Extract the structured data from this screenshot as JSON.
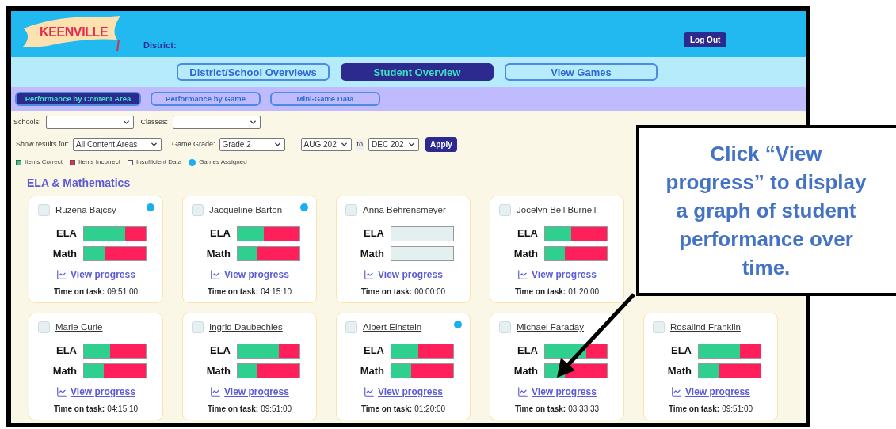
{
  "header": {
    "logo": "KEENVILLE",
    "district_label": "District:",
    "logout": "Log Out"
  },
  "nav_tabs": [
    {
      "label": "District/School Overviews",
      "selected": false
    },
    {
      "label": "Student Overview",
      "selected": true
    },
    {
      "label": "View Games",
      "selected": false
    }
  ],
  "sub_tabs": [
    {
      "label": "Performance by Content Area",
      "selected": true
    },
    {
      "label": "Performance by Game",
      "selected": false
    },
    {
      "label": "Mini-Game Data",
      "selected": false
    }
  ],
  "filters": {
    "schools_label": "Schools:",
    "classes_label": "Classes:",
    "show_results_label": "Show results for:",
    "show_results_value": "All Content Areas",
    "game_grade_label": "Game Grade:",
    "game_grade_value": "Grade 2",
    "date_from": "AUG 202",
    "to": "to",
    "date_to": "DEC 202",
    "apply": "Apply"
  },
  "legend": [
    {
      "label": "Items Correct",
      "color": "#2fd08f",
      "kind": "square"
    },
    {
      "label": "Items Incorrect",
      "color": "#ff1f5a",
      "kind": "square"
    },
    {
      "label": "Insufficient Data",
      "color": "#ffffff",
      "kind": "square"
    },
    {
      "label": "Games Assigned",
      "color": "#1ab0f0",
      "kind": "dot"
    }
  ],
  "section_title": "ELA & Mathematics",
  "rows": [
    [
      {
        "name": "Ruzena Bajcsy",
        "checked": false,
        "games_assigned": true,
        "insufficient_data": false,
        "bars": [
          {
            "label": "ELA",
            "level": 0.67
          },
          {
            "label": "Math",
            "level": 0.33
          }
        ],
        "link": "View progress",
        "time_label": "Time on task:",
        "time": "09:51:00"
      },
      {
        "name": "Jacqueline Barton",
        "checked": false,
        "games_assigned": true,
        "insufficient_data": false,
        "bars": [
          {
            "label": "ELA",
            "level": 0.42
          },
          {
            "label": "Math",
            "level": 0.32
          }
        ],
        "link": "View progress",
        "time_label": "Time on task:",
        "time": "04:15:10"
      },
      {
        "name": "Anna Behrensmeyer",
        "checked": false,
        "games_assigned": false,
        "insufficient_data": true,
        "bars": [
          {
            "label": "ELA"
          },
          {
            "label": "Math"
          }
        ],
        "link": "View progress",
        "time_label": "Time on task:",
        "time": "00:00:00"
      },
      {
        "name": "Jocelyn Bell Burnell",
        "checked": false,
        "games_assigned": false,
        "insufficient_data": false,
        "bars": [
          {
            "label": "ELA",
            "level": 0.42
          },
          {
            "label": "Math",
            "level": 0.32
          }
        ],
        "link": "View progress",
        "time_label": "Time on task:",
        "time": "01:20:00"
      }
    ],
    [
      {
        "name": "Marie Curie",
        "checked": false,
        "games_assigned": false,
        "insufficient_data": false,
        "bars": [
          {
            "label": "ELA",
            "level": 0.42
          },
          {
            "label": "Math",
            "level": 0.32
          }
        ],
        "link": "View progress",
        "time_label": "Time on task:",
        "time": "04:15:10"
      },
      {
        "name": "Ingrid Daubechies",
        "checked": false,
        "games_assigned": false,
        "insufficient_data": false,
        "bars": [
          {
            "label": "ELA",
            "level": 0.67
          },
          {
            "label": "Math",
            "level": 0.32
          }
        ],
        "link": "View progress",
        "time_label": "Time on task:",
        "time": "09:51:00"
      },
      {
        "name": "Albert Einstein",
        "checked": false,
        "games_assigned": true,
        "insufficient_data": false,
        "bars": [
          {
            "label": "ELA",
            "level": 0.43
          },
          {
            "label": "Math",
            "level": 0.32
          }
        ],
        "link": "View progress",
        "time_label": "Time on task:",
        "time": "01:20:00"
      },
      {
        "name": "Michael Faraday",
        "checked": false,
        "games_assigned": false,
        "insufficient_data": false,
        "bars": [
          {
            "label": "ELA",
            "level": 0.67
          },
          {
            "label": "Math",
            "level": 0.32
          }
        ],
        "link": "View progress",
        "time_label": "Time on task:",
        "time": "03:33:33"
      },
      {
        "name": "Rosalind Franklin",
        "checked": false,
        "games_assigned": false,
        "insufficient_data": false,
        "bars": [
          {
            "label": "ELA",
            "level": 0.67
          },
          {
            "label": "Math",
            "level": 0.32
          }
        ],
        "link": "View progress",
        "time_label": "Time on task:",
        "time": "09:51:00"
      }
    ]
  ],
  "callout": {
    "text": "Click “View progress” to display a graph of student performance over time."
  }
}
